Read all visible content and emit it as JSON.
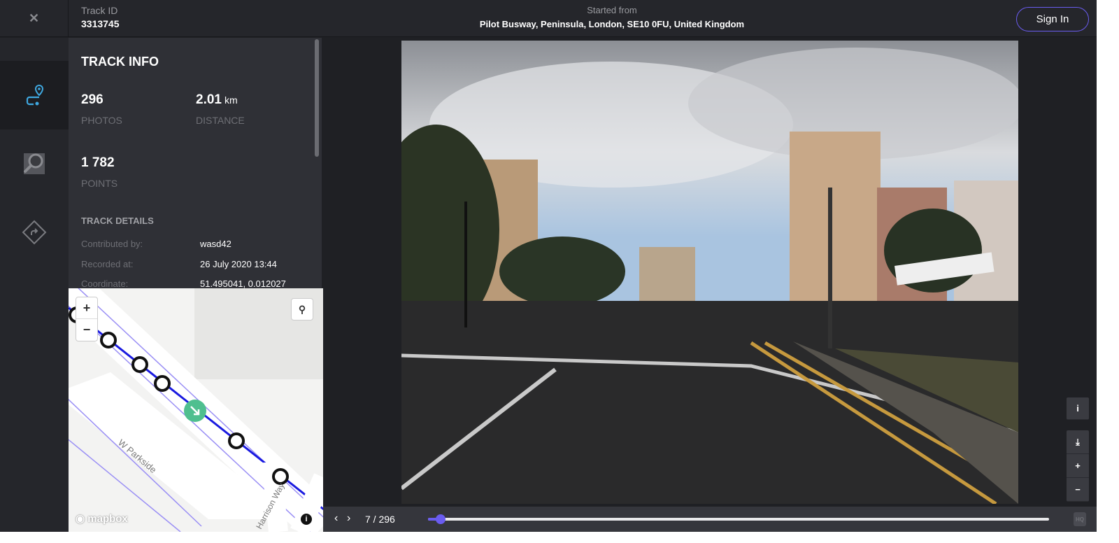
{
  "header": {
    "close_icon": "close-icon",
    "track_id_label": "Track ID",
    "track_id": "3313745",
    "started_label": "Started from",
    "started_value": "Pilot Busway, Peninsula, London, SE10 0FU, United Kingdom",
    "sign_in": "Sign In"
  },
  "rail": {
    "items": [
      {
        "icon": "track-route-icon",
        "active": true
      },
      {
        "icon": "map-search-icon"
      },
      {
        "icon": "directions-icon"
      }
    ]
  },
  "track_info": {
    "title": "TRACK INFO",
    "photos": {
      "value": "296",
      "label": "PHOTOS"
    },
    "distance": {
      "value": "2.01",
      "unit": "km",
      "label": "DISTANCE"
    },
    "points": {
      "value": "1 782",
      "label": "POINTS"
    },
    "details_title": "TRACK DETAILS",
    "details": [
      {
        "key": "Contributed by:",
        "value": "wasd42"
      },
      {
        "key": "Recorded at:",
        "value": "26 July 2020 13:44"
      },
      {
        "key": "Coordinate:",
        "value": "51.495041, 0.012027"
      }
    ]
  },
  "map": {
    "zoom_in": "+",
    "zoom_out": "−",
    "street1": "W Parkside",
    "street2": "Harrison Way",
    "attribution": "mapbox",
    "info": "i"
  },
  "viewer": {
    "controls": {
      "info": "i",
      "download": "⤓",
      "zoom_in": "+",
      "zoom_out": "−"
    },
    "prev": "‹",
    "next": "›",
    "counter": "7 / 296",
    "current": 7,
    "total": 296,
    "hq": "HQ",
    "accent": "#6a5cf0"
  }
}
